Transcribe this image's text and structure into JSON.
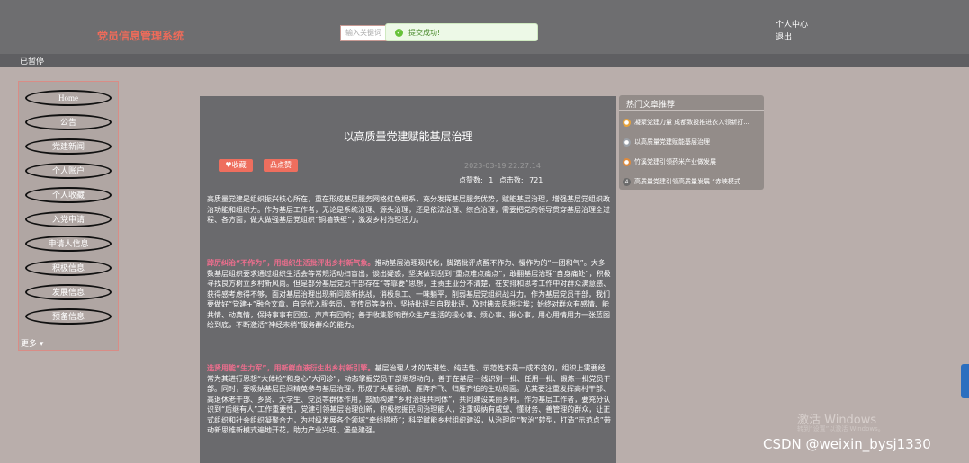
{
  "header": {
    "title": "党员信息管理系统",
    "search_placeholder": "输入关键词",
    "user_center": "个人中心",
    "logout": "退出"
  },
  "toast": {
    "text": "提交成功!",
    "icon": "check-circle-icon",
    "color": "#67c23a"
  },
  "status": {
    "text": "已暂停"
  },
  "sidebar": {
    "items": [
      {
        "label": "Home"
      },
      {
        "label": "公告"
      },
      {
        "label": "党建新闻"
      },
      {
        "label": "个人账户"
      },
      {
        "label": "个人收藏"
      },
      {
        "label": "入党申请"
      },
      {
        "label": "申请人信息"
      },
      {
        "label": "积极信息"
      },
      {
        "label": "发展信息"
      },
      {
        "label": "预备信息"
      }
    ],
    "more": "更多 ▾"
  },
  "article": {
    "title": "以高质量党建赋能基层治理",
    "collect_label": "♥收藏",
    "like_label": "凸点赞",
    "date": "2023-03-19 22:27:14",
    "stats": "点赞数: 1  点击数: 721",
    "paragraphs": [
      {
        "highlight": "",
        "text": "高质量党建是组织振兴核心所在，重在形成基层服务网格红色根系，充分发挥基层服务优势，赋能基层治理，增强基层党组织政治功能和组织力。作为基层工作者，无论是系统治理、源头治理，还是依法治理、综合治理，需要把党的领导贯穿基层治理全过程、各方面，做大做强基层党组织“铜墙铁壁”，激发乡村治理活力。"
      },
      {
        "highlight": "",
        "text": ""
      },
      {
        "highlight": "踔厉纠治“不作为”，用组织生活批评出乡村新气象。",
        "text": "推动基层治理现代化，脚踏批评点醒不作为、慢作为的“一团和气”。大多数基层组织要求通过组织生活会等常规活动扫盲出，谈出疑惑，坚决做到刮到“重点难点痛点”，敢翻基层治理“自身痛处”，积极寻找良方树立乡村新风尚。但是部分基层党员干部存在“等靠要”思想，主责主业分不清楚，在安排和思考工作中对群众满意感、获得感考虑得不够，面对基层治理出现新问题新挑战，消极怠工、一味躺平，削弱基层党组织战斗力。作为基层党员干部，我们要做好“党建+”融合文章，自觉代入服务员、宣传员等身份，坚持批评与自我批评，及时拂去思想尘埃；始终对群众有感情、能共情、动真情，保持事事有回应、声声有回响；善于收集影响群众生产生活的操心事、烦心事、揪心事，用心用情用力一张蓝图绘到底，不断激活“神经末梢”服务群众的能力。"
      },
      {
        "highlight": "选贤用能“生力军”，用新鲜血液衍生出乡村新引擎。",
        "text": "基层治理人才的先进性、纯洁性、示范性不是一成不变的，组织上需要经常为其进行思想“大体检”和身心“大问诊”，动态掌握党员干部思想动向，善于在基层一线识别一批、任用一批、锻炼一批党员干部。同时，要吸纳基层民间精英参与基层治理，形成了头雁领航、雁阵齐飞、归雁齐追的生动局面。尤其要注重发挥高村干部、高退休老干部、乡贤、大学生、党员等群体作用，鼓励构建“乡村治理共同体”，共同建设美丽乡村。作为基层工作者，要充分认识到“后继有人”工作重要性，党建引领基层治理创新，积极挖掘民间治理能人，注重吸纳有威望、懂财务、善管理的群众，让正式组织和社会组织凝聚合力，为村级发展各个领域“牵线搭桥”；科学赋能乡村组织建设，从治理向“智治”转型，打造“示范点”带动新思维新模式遍地开花，助力产业兴旺、堡垒建强。"
      }
    ]
  },
  "hot": {
    "title": "热门文章推荐",
    "items": [
      {
        "text": "凝聚党建力量 成都致投推进农入领新打...",
        "icon": "fire-icon",
        "color": "#e8a33a"
      },
      {
        "text": "以高质量党建赋能基层治理",
        "icon": "thumb-icon",
        "color": "#9aa0a8"
      },
      {
        "text": "竹溪党建引领药米产业做发展",
        "icon": "sun-icon",
        "color": "#e08a3a"
      },
      {
        "text": "高质量党建引领高质量发展 “赤峡模式...",
        "icon": "number-4-icon",
        "color": "#6b6b6b"
      }
    ]
  },
  "overlay": {
    "watermark": "激活 Windows",
    "watermark_sub": "转到“设置”以激活 Windows。",
    "csdn": "CSDN @weixin_bysj1330"
  }
}
